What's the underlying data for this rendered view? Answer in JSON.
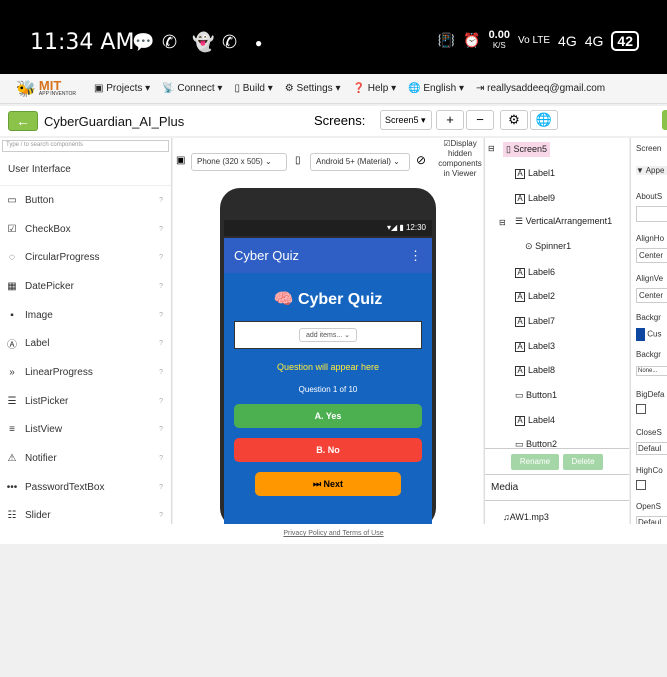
{
  "status": {
    "time": "11:34 AM",
    "speed": "0.00",
    "speed_unit": "K/S",
    "network1": "Vo LTE",
    "network2": "4G",
    "network3": "4G",
    "battery": "42"
  },
  "topbar": {
    "logo": "MIT",
    "logo_sub": "APP INVENTOR",
    "menus": [
      "Projects",
      "Connect",
      "Build",
      "Settings",
      "Help",
      "English"
    ],
    "account": "reallysaddeeq@gmail.com"
  },
  "bar2": {
    "project": "CyberGuardian_AI_Plus",
    "screens_label": "Screens:",
    "screen_select": "Screen5",
    "add": "+",
    "remove": "−"
  },
  "palette": {
    "search_placeholder": "Type / to search components",
    "category": "User Interface",
    "items": [
      "Button",
      "CheckBox",
      "CircularProgress",
      "DatePicker",
      "Image",
      "Label",
      "LinearProgress",
      "ListPicker",
      "ListView",
      "Notifier",
      "PasswordTextBox",
      "Slider"
    ]
  },
  "viewer": {
    "device": "Phone (320 x 505)",
    "theme": "Android 5+ (Material)",
    "display_hidden": "Display hidden components in Viewer",
    "phone_time": "12:30",
    "app_title": "Cyber Quiz",
    "quiz_title": "🧠 Cyber Quiz",
    "spinner": "add items...",
    "question": "Question will appear here",
    "qnum": "Question 1 of 10",
    "ans_a": "A. Yes",
    "ans_b": "B. No",
    "next": "⏭ Next"
  },
  "tree": {
    "items": [
      "Screen5",
      "Label1",
      "Label9",
      "VerticalArrangement1",
      "Spinner1",
      "Label6",
      "Label2",
      "Label7",
      "Label3",
      "Label8",
      "Button1",
      "Label4",
      "Button2"
    ],
    "rename": "Rename",
    "delete": "Delete",
    "media": "Media",
    "media_file": "AW1.mp3"
  },
  "props": {
    "labels": [
      "Screen",
      "Appe",
      "AboutS",
      "AlignHo",
      "Center",
      "AlignVe",
      "Center",
      "Backgr",
      "Cus",
      "Backgr",
      "None...",
      "BigDefa",
      "CloseS",
      "Defaul",
      "HighCo",
      "OpenS",
      "Defaul"
    ]
  },
  "footer": {
    "text": "Privacy Policy and Terms of Use"
  },
  "colors": {
    "accent": "#8bc34a",
    "quiz_bg": "#1565c0",
    "green": "#4caf50",
    "red": "#f44336",
    "orange": "#ff9800"
  }
}
